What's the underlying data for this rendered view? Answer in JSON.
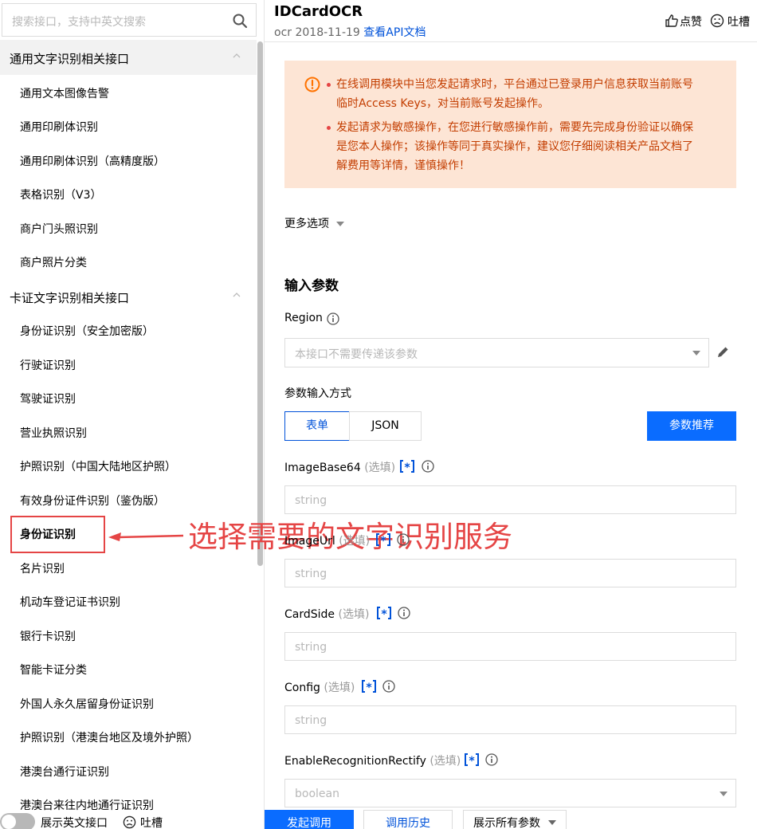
{
  "sidebar": {
    "search_placeholder": "搜索接口，支持中英文搜索",
    "group1_label": "通用文字识别相关接口",
    "group2_label": "卡证文字识别相关接口",
    "items": [
      "通用文本图像告警",
      "通用印刷体识别",
      "通用印刷体识别（高精度版）",
      "表格识别（V3）",
      "商户门头照识别",
      "商户照片分类",
      "身份证识别（安全加密版）",
      "行驶证识别",
      "驾驶证识别",
      "营业执照识别",
      "护照识别（中国大陆地区护照）",
      "有效身份证件识别（鉴伪版）",
      "身份证识别",
      "名片识别",
      "机动车登记证书识别",
      "银行卡识别",
      "智能卡证分类",
      "外国人永久居留身份证识别",
      "护照识别（港澳台地区及境外护照）",
      "港澳台通行证识别",
      "港澳台来往内地通行证识别"
    ],
    "active_item": "身份证识别",
    "footer": {
      "toggle_label": "展示英文接口",
      "feedback_label": "吐槽"
    }
  },
  "annotation": {
    "text": "选择需要的文字识别服务",
    "color": "#e54545"
  },
  "header": {
    "title": "IDCardOCR",
    "meta": "ocr 2018-11-19",
    "doc_link": "查看API文档",
    "like_label": "点赞",
    "feedback_label": "吐槽"
  },
  "warning": {
    "p1": "在线调用模块中当您发起请求时，平台通过已登录用户信息获取当前账号临时Access Keys，对当前账号发起操作。",
    "p2": "发起请求为敏感操作，在您进行敏感操作前，需要先完成身份验证以确保是您本人操作；该操作等同于真实操作，建议您仔细阅读相关产品文档了解费用等详情，谨慎操作！"
  },
  "more_options": "更多选项",
  "section_title": "输入参数",
  "region": {
    "label": "Region",
    "placeholder": "本接口不需要传递该参数"
  },
  "param_mode": {
    "label": "参数输入方式",
    "tab_form": "表单",
    "tab_json": "JSON",
    "recommend": "参数推荐"
  },
  "fields": {
    "optional_text": "(选填)",
    "f1": {
      "name": "ImageBase64",
      "placeholder": "string"
    },
    "f2": {
      "name": "ImageUrl",
      "placeholder": "string"
    },
    "f3": {
      "name": "CardSide",
      "placeholder": "string"
    },
    "f4": {
      "name": "Config",
      "placeholder": "string"
    },
    "f5": {
      "name": "EnableRecognitionRectify",
      "placeholder": "boolean"
    }
  },
  "bottom": {
    "invoke": "发起调用",
    "history": "调用历史",
    "show_all": "展示所有参数"
  },
  "colors": {
    "primary": "#0a6cff",
    "link": "#0052d9",
    "warning_bg": "#fde5d5",
    "warning_text": "#c33d00",
    "annotation": "#e54545"
  }
}
